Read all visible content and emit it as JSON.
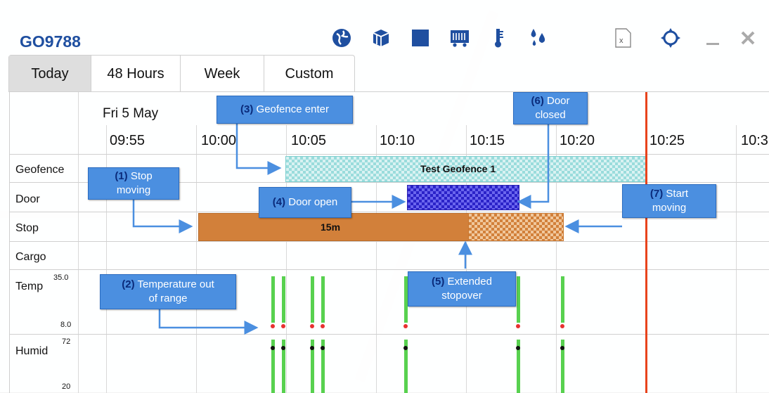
{
  "header": {
    "title": "GO9788",
    "icons": [
      "globe-icon",
      "cube-icon",
      "square-icon",
      "bus-icon",
      "thermometer-icon",
      "droplets-icon",
      "excel-export-icon",
      "crosshair-icon",
      "minimize-icon",
      "close-icon"
    ]
  },
  "tabs": [
    {
      "label": "Today",
      "active": true
    },
    {
      "label": "48 Hours",
      "active": false
    },
    {
      "label": "Week",
      "active": false
    },
    {
      "label": "Custom",
      "active": false
    }
  ],
  "timeline": {
    "date": "Fri 5 May",
    "ticks": [
      "09:55",
      "10:00",
      "10:05",
      "10:10",
      "10:15",
      "10:20",
      "10:25",
      "10:3"
    ]
  },
  "rows": {
    "geofence": "Geofence",
    "door": "Door",
    "stop": "Stop",
    "cargo": "Cargo",
    "temp": "Temp",
    "humid": "Humid"
  },
  "scales": {
    "temp_max": "35.0",
    "temp_min": "8.0",
    "humid_max": "72",
    "humid_min": "20"
  },
  "bars": {
    "geofence_label": "Test Geofence 1",
    "stop_label": "15m"
  },
  "callouts": {
    "c1_num": "(1)",
    "c1_text": " Stop",
    "c1_text2": "moving",
    "c2_num": "(2)",
    "c2_text": " Temperature out",
    "c2_text2": "of range",
    "c3_num": "(3)",
    "c3_text": " Geofence enter",
    "c4_num": "(4)",
    "c4_text": " Door open",
    "c5_num": "(5)",
    "c5_text": " Extended",
    "c5_text2": "stopover",
    "c6_num": "(6)",
    "c6_text": " Door",
    "c6_text2": "closed",
    "c7_num": "(7)",
    "c7_text": " Start",
    "c7_text2": "moving"
  },
  "colors": {
    "brand": "#1f4fa0",
    "geofence": "#8fd6d6",
    "door": "#3a32d6",
    "stop": "#d2803a",
    "now_line": "#e8431c",
    "callout": "#4b8fe0",
    "sensor_bar": "#58d14f"
  }
}
